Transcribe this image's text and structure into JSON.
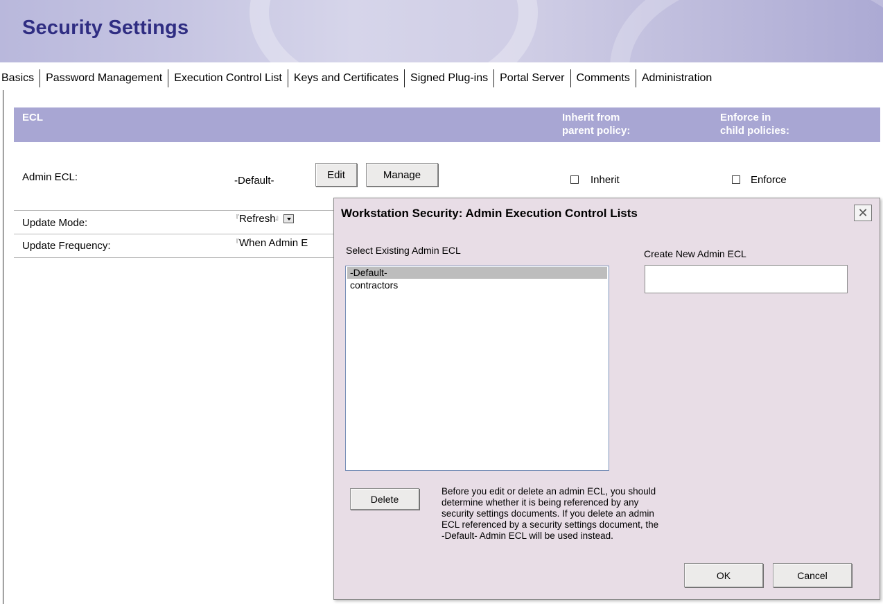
{
  "page": {
    "title": "Security Settings",
    "tabs": [
      "Basics",
      "Password Management",
      "Execution Control List",
      "Keys and Certificates",
      "Signed Plug-ins",
      "Portal Server",
      "Comments",
      "Administration"
    ]
  },
  "ecl_section": {
    "header": "ECL",
    "inherit_header_line1": "Inherit from",
    "inherit_header_line2": "parent policy:",
    "enforce_header_line1": "Enforce in",
    "enforce_header_line2": "child policies:",
    "admin_ecl_label": "Admin ECL:",
    "admin_ecl_value": "-Default-",
    "edit_label": "Edit",
    "manage_label": "Manage",
    "inherit_label": "Inherit",
    "inherit_checked": false,
    "enforce_label": "Enforce",
    "enforce_checked": false,
    "update_mode_label": "Update Mode:",
    "update_mode_value": "Refresh",
    "update_frequency_label": "Update Frequency:",
    "update_frequency_value": "When Admin E"
  },
  "dialog": {
    "title": "Workstation Security:  Admin Execution Control Lists",
    "select_label": "Select Existing Admin ECL",
    "create_label": "Create New Admin ECL",
    "new_ecl_value": "",
    "list_items": [
      "-Default-",
      "contractors"
    ],
    "selected_item": "-Default-",
    "delete_label": "Delete",
    "note": "Before you edit or delete an admin ECL, you should determine whether it is being referenced by any security settings documents. If you delete an admin ECL referenced by a security settings document, the -Default- Admin ECL will be used instead.",
    "ok_label": "OK",
    "cancel_label": "Cancel"
  },
  "colors": {
    "title_text": "#2f2d82",
    "header_bar": "#a8a6d3",
    "dialog_bg": "#e8dde6",
    "list_selection": "#bdbdbd"
  }
}
